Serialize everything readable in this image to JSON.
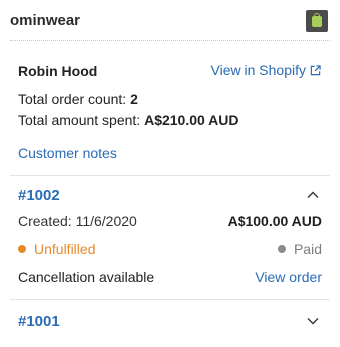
{
  "header": {
    "store_name": "ominwear"
  },
  "customer": {
    "name": "Robin Hood",
    "view_link_label": "View in Shopify",
    "total_order_count_label": "Total order count:",
    "total_order_count": "2",
    "total_spent_label": "Total amount spent:",
    "total_spent": "A$210.00 AUD",
    "notes_link_label": "Customer notes"
  },
  "orders": [
    {
      "id": "#1002",
      "expanded": true,
      "created": "Created: 11/6/2020",
      "amount": "A$100.00 AUD",
      "fulfillment_status": "Unfulfilled",
      "payment_status": "Paid",
      "cancellation": "Cancellation available",
      "view_order_label": "View order"
    },
    {
      "id": "#1001",
      "expanded": false
    }
  ],
  "colors": {
    "link": "#2a6bb5",
    "unfulfilled": "#e58a2a",
    "paid": "#8a8a8a"
  }
}
